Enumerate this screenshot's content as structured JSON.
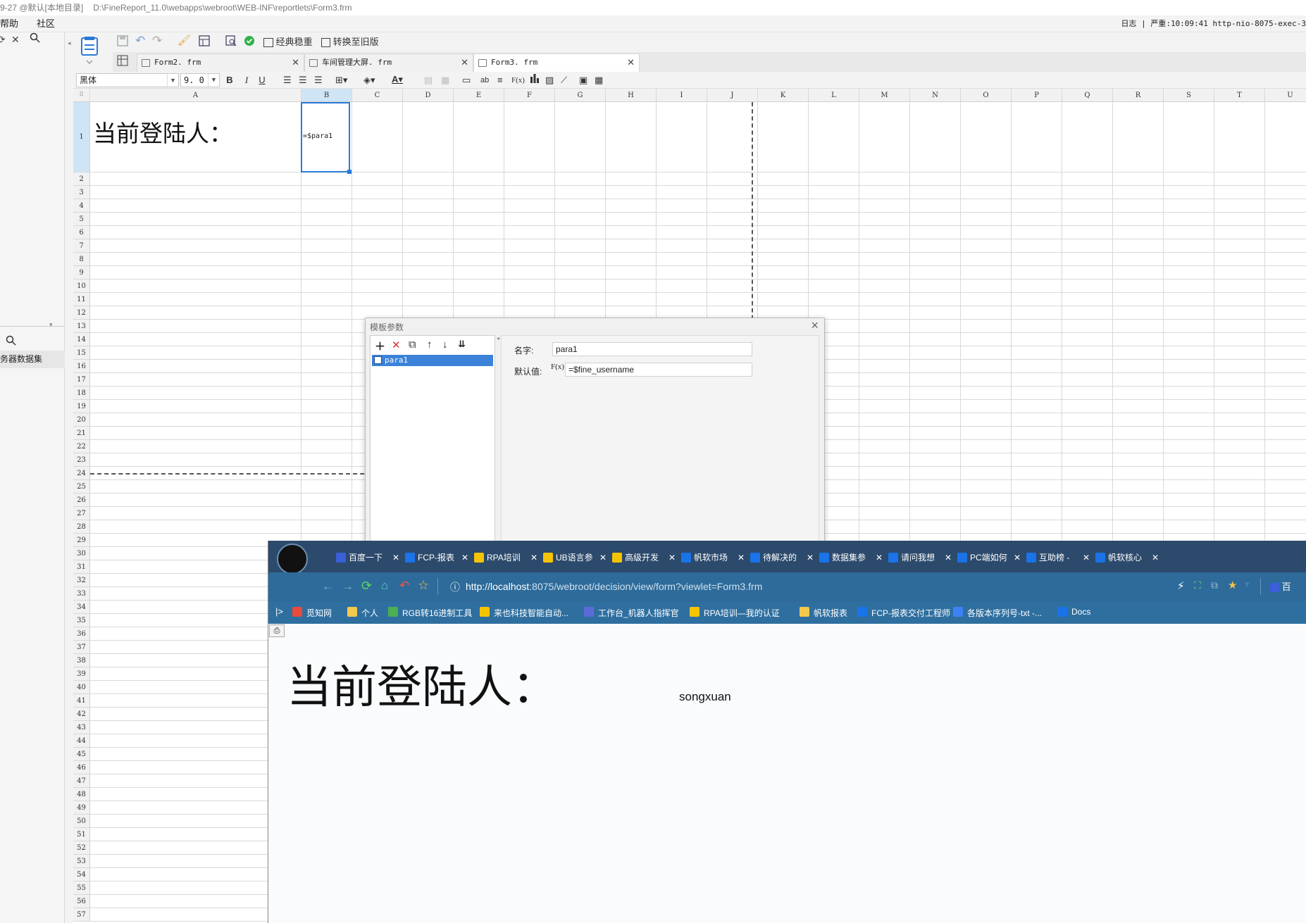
{
  "window": {
    "title_prefix": "9-27 @默认[本地目录]",
    "path": "D:\\FineReport_11.0\\webapps\\webroot\\WEB-INF\\reportlets\\Form3.frm"
  },
  "menu": {
    "help": "帮助",
    "community": "社区"
  },
  "log": {
    "label": "日志",
    "sep": "|",
    "level": "严重",
    "time": "10:09:41",
    "thread": "http-nio-8075-exec-3"
  },
  "left_panel": {
    "datasource_label": "务器数据集"
  },
  "toolbar": {
    "classic_stable": "经典稳重",
    "convert_old": "转换至旧版"
  },
  "file_tabs": [
    {
      "label": "Form2. frm"
    },
    {
      "label": "车间管理大屏. frm"
    },
    {
      "label": "Form3. frm"
    }
  ],
  "format": {
    "font": "黑体",
    "size": "9. 0",
    "bold": "B",
    "italic": "I",
    "underline": "U",
    "fx": "F(x)",
    "ab": "ab"
  },
  "sheet": {
    "columns": [
      "A",
      "B",
      "C",
      "D",
      "E",
      "F",
      "G",
      "H",
      "I",
      "J",
      "K",
      "L",
      "M",
      "N",
      "O",
      "P",
      "Q",
      "R",
      "S",
      "T",
      "U"
    ],
    "rows": [
      "1",
      "2",
      "3",
      "4",
      "5",
      "6",
      "7",
      "8",
      "9",
      "10",
      "11",
      "12",
      "13",
      "14",
      "15",
      "16",
      "17",
      "18",
      "19",
      "20",
      "21",
      "22",
      "23",
      "24",
      "25",
      "26",
      "27",
      "28",
      "29",
      "30",
      "31",
      "32",
      "33",
      "34",
      "35",
      "36",
      "37",
      "38",
      "39",
      "40",
      "41",
      "42",
      "43",
      "44",
      "45",
      "46",
      "47",
      "48",
      "49",
      "50",
      "51",
      "52",
      "53",
      "54",
      "55",
      "56",
      "57"
    ],
    "a1": "当前登陆人：",
    "b1": "=$para1",
    "selected_cell": "B1"
  },
  "dialog": {
    "title": "模板参数",
    "params": [
      "para1"
    ],
    "name_label": "名字:",
    "name_value": "para1",
    "default_label": "默认值:",
    "default_value": "=$fine_username",
    "fx_label": "F(x)"
  },
  "browser": {
    "tabs": [
      {
        "label": "百度一下",
        "color": "#3a5fd9"
      },
      {
        "label": "FCP-报表",
        "color": "#1a73e8"
      },
      {
        "label": "RPA培训",
        "color": "#f5c400"
      },
      {
        "label": "UB语言参",
        "color": "#f5c400"
      },
      {
        "label": "高级开发",
        "color": "#f5c400"
      },
      {
        "label": "帆软市场",
        "color": "#1a73e8"
      },
      {
        "label": "待解决的",
        "color": "#1a73e8"
      },
      {
        "label": "数据集参",
        "color": "#1a73e8"
      },
      {
        "label": "请问我想",
        "color": "#1a73e8"
      },
      {
        "label": "PC端如何",
        "color": "#1a73e8"
      },
      {
        "label": "互助榜 - ",
        "color": "#1a73e8"
      },
      {
        "label": "帆软核心",
        "color": "#1a73e8"
      }
    ],
    "url_host": "http://localhost",
    "url_rest": ":8075/webroot/decision/view/form?viewlet=Form3.frm",
    "bookmarks": [
      {
        "label": "觅知网",
        "color": "#e84a3c"
      },
      {
        "label": "个人",
        "color": "#f2c94c"
      },
      {
        "label": "RGB转16进制工具",
        "color": "#4caf50"
      },
      {
        "label": "来也科技智能自动...",
        "color": "#f5c400"
      },
      {
        "label": "工作台_机器人指挥官",
        "color": "#5b6bd8"
      },
      {
        "label": "RPA培训—我的认证",
        "color": "#f5c400"
      },
      {
        "label": "帆软报表",
        "color": "#f2c94c"
      },
      {
        "label": "FCP-报表交付工程师",
        "color": "#1a73e8"
      },
      {
        "label": "各版本序列号-txt -...",
        "color": "#3b82f6"
      },
      {
        "label": "Docs",
        "color": "#1a73e8"
      }
    ],
    "page_label": "当前登陆人：",
    "page_value": "songxuan",
    "truncated_tab": "百"
  }
}
